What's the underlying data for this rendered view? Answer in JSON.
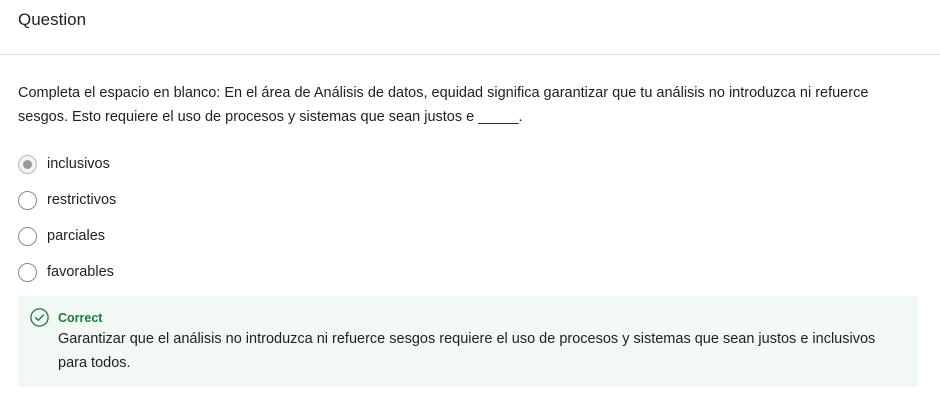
{
  "header": {
    "title": "Question"
  },
  "question": {
    "text": "Completa el espacio en blanco: En el área de Análisis de datos, equidad significa garantizar que tu análisis no introduzca ni refuerce sesgos. Esto requiere el uso de procesos y sistemas que sean justos e _____."
  },
  "options": [
    {
      "label": "inclusivos",
      "selected": true
    },
    {
      "label": "restrictivos",
      "selected": false
    },
    {
      "label": "parciales",
      "selected": false
    },
    {
      "label": "favorables",
      "selected": false
    }
  ],
  "feedback": {
    "status": "Correct",
    "icon": "check-circle-icon",
    "text": "Garantizar que el análisis no introduzca ni refuerce sesgos requiere el uso de procesos y sistemas que sean justos e inclusivos para todos.",
    "accent_color": "#1f7a3a",
    "background_color": "#f2f8f3"
  }
}
